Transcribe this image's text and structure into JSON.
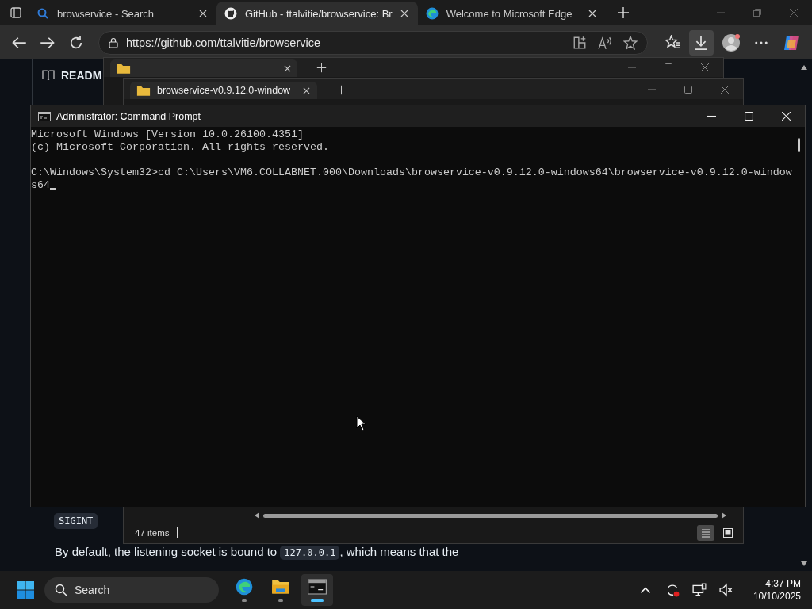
{
  "browser": {
    "tabs": [
      {
        "kind": "search",
        "title": "browservice - Search",
        "selected": false
      },
      {
        "kind": "github",
        "title": "GitHub - ttalvitie/browservice: Br",
        "selected": true
      },
      {
        "kind": "edge",
        "title": "Welcome to Microsoft Edge",
        "selected": false
      }
    ],
    "address": "https://github.com/ttalvitie/browservice"
  },
  "github": {
    "readme_tab": "READM",
    "code_chip": "SIGINT",
    "paragraph": {
      "before": "By default, the listening socket is bound to ",
      "code": "127.0.0.1",
      "after": ", which means that the"
    }
  },
  "explorer_front": {
    "tab": "browservice-v0.9.12.0-window",
    "status": "47 items"
  },
  "cmd": {
    "title": "Administrator: Command Prompt",
    "lines": [
      "Microsoft Windows [Version 10.0.26100.4351]",
      "(c) Microsoft Corporation. All rights reserved."
    ],
    "command": "C:\\Windows\\System32>cd C:\\Users\\VM6.COLLABNET.000\\Downloads\\browservice-v0.9.12.0-windows64\\browservice-v0.9.12.0-windows64"
  },
  "taskbar": {
    "search_placeholder": "Search",
    "apps": [
      {
        "kind": "edge",
        "active": false
      },
      {
        "kind": "explorer",
        "active": false
      },
      {
        "kind": "terminal",
        "active": true
      }
    ],
    "time": "4:37 PM",
    "date": "10/10/2025"
  }
}
